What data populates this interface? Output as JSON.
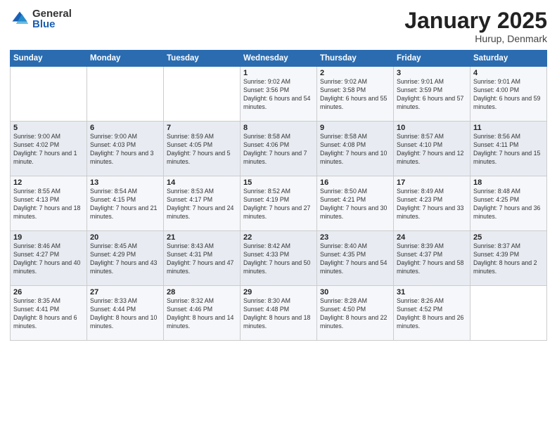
{
  "logo": {
    "general": "General",
    "blue": "Blue"
  },
  "title": "January 2025",
  "location": "Hurup, Denmark",
  "weekdays": [
    "Sunday",
    "Monday",
    "Tuesday",
    "Wednesday",
    "Thursday",
    "Friday",
    "Saturday"
  ],
  "weeks": [
    [
      null,
      null,
      null,
      {
        "day": "1",
        "sunrise": "9:02 AM",
        "sunset": "3:56 PM",
        "daylight": "6 hours and 54 minutes."
      },
      {
        "day": "2",
        "sunrise": "9:02 AM",
        "sunset": "3:58 PM",
        "daylight": "6 hours and 55 minutes."
      },
      {
        "day": "3",
        "sunrise": "9:01 AM",
        "sunset": "3:59 PM",
        "daylight": "6 hours and 57 minutes."
      },
      {
        "day": "4",
        "sunrise": "9:01 AM",
        "sunset": "4:00 PM",
        "daylight": "6 hours and 59 minutes."
      }
    ],
    [
      {
        "day": "5",
        "sunrise": "9:00 AM",
        "sunset": "4:02 PM",
        "daylight": "7 hours and 1 minute."
      },
      {
        "day": "6",
        "sunrise": "9:00 AM",
        "sunset": "4:03 PM",
        "daylight": "7 hours and 3 minutes."
      },
      {
        "day": "7",
        "sunrise": "8:59 AM",
        "sunset": "4:05 PM",
        "daylight": "7 hours and 5 minutes."
      },
      {
        "day": "8",
        "sunrise": "8:58 AM",
        "sunset": "4:06 PM",
        "daylight": "7 hours and 7 minutes."
      },
      {
        "day": "9",
        "sunrise": "8:58 AM",
        "sunset": "4:08 PM",
        "daylight": "7 hours and 10 minutes."
      },
      {
        "day": "10",
        "sunrise": "8:57 AM",
        "sunset": "4:10 PM",
        "daylight": "7 hours and 12 minutes."
      },
      {
        "day": "11",
        "sunrise": "8:56 AM",
        "sunset": "4:11 PM",
        "daylight": "7 hours and 15 minutes."
      }
    ],
    [
      {
        "day": "12",
        "sunrise": "8:55 AM",
        "sunset": "4:13 PM",
        "daylight": "7 hours and 18 minutes."
      },
      {
        "day": "13",
        "sunrise": "8:54 AM",
        "sunset": "4:15 PM",
        "daylight": "7 hours and 21 minutes."
      },
      {
        "day": "14",
        "sunrise": "8:53 AM",
        "sunset": "4:17 PM",
        "daylight": "7 hours and 24 minutes."
      },
      {
        "day": "15",
        "sunrise": "8:52 AM",
        "sunset": "4:19 PM",
        "daylight": "7 hours and 27 minutes."
      },
      {
        "day": "16",
        "sunrise": "8:50 AM",
        "sunset": "4:21 PM",
        "daylight": "7 hours and 30 minutes."
      },
      {
        "day": "17",
        "sunrise": "8:49 AM",
        "sunset": "4:23 PM",
        "daylight": "7 hours and 33 minutes."
      },
      {
        "day": "18",
        "sunrise": "8:48 AM",
        "sunset": "4:25 PM",
        "daylight": "7 hours and 36 minutes."
      }
    ],
    [
      {
        "day": "19",
        "sunrise": "8:46 AM",
        "sunset": "4:27 PM",
        "daylight": "7 hours and 40 minutes."
      },
      {
        "day": "20",
        "sunrise": "8:45 AM",
        "sunset": "4:29 PM",
        "daylight": "7 hours and 43 minutes."
      },
      {
        "day": "21",
        "sunrise": "8:43 AM",
        "sunset": "4:31 PM",
        "daylight": "7 hours and 47 minutes."
      },
      {
        "day": "22",
        "sunrise": "8:42 AM",
        "sunset": "4:33 PM",
        "daylight": "7 hours and 50 minutes."
      },
      {
        "day": "23",
        "sunrise": "8:40 AM",
        "sunset": "4:35 PM",
        "daylight": "7 hours and 54 minutes."
      },
      {
        "day": "24",
        "sunrise": "8:39 AM",
        "sunset": "4:37 PM",
        "daylight": "7 hours and 58 minutes."
      },
      {
        "day": "25",
        "sunrise": "8:37 AM",
        "sunset": "4:39 PM",
        "daylight": "8 hours and 2 minutes."
      }
    ],
    [
      {
        "day": "26",
        "sunrise": "8:35 AM",
        "sunset": "4:41 PM",
        "daylight": "8 hours and 6 minutes."
      },
      {
        "day": "27",
        "sunrise": "8:33 AM",
        "sunset": "4:44 PM",
        "daylight": "8 hours and 10 minutes."
      },
      {
        "day": "28",
        "sunrise": "8:32 AM",
        "sunset": "4:46 PM",
        "daylight": "8 hours and 14 minutes."
      },
      {
        "day": "29",
        "sunrise": "8:30 AM",
        "sunset": "4:48 PM",
        "daylight": "8 hours and 18 minutes."
      },
      {
        "day": "30",
        "sunrise": "8:28 AM",
        "sunset": "4:50 PM",
        "daylight": "8 hours and 22 minutes."
      },
      {
        "day": "31",
        "sunrise": "8:26 AM",
        "sunset": "4:52 PM",
        "daylight": "8 hours and 26 minutes."
      },
      null
    ]
  ]
}
